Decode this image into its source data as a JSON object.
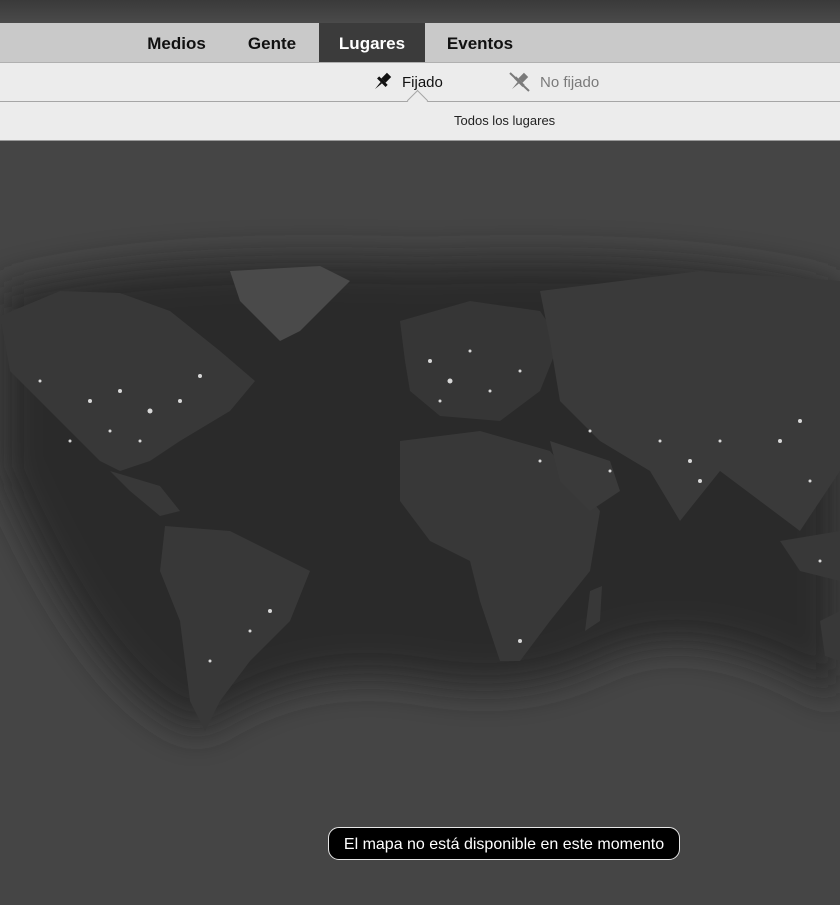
{
  "tabs": [
    {
      "label": "Medios",
      "active": false
    },
    {
      "label": "Gente",
      "active": false
    },
    {
      "label": "Lugares",
      "active": true
    },
    {
      "label": "Eventos",
      "active": false
    }
  ],
  "pin_filter": {
    "pinned_label": "Fijado",
    "unpinned_label": "No fijado",
    "pinned_icon": "pin-icon",
    "unpinned_icon": "pin-off-icon"
  },
  "places_filter": {
    "label": "Todos los lugares"
  },
  "map": {
    "notice": "El mapa no está disponible en este momento"
  },
  "colors": {
    "active_tab": "#3b3b3b",
    "tab_bar": "#c9c9c9",
    "map_background": "#454545",
    "land": "#333333",
    "ocean": "#2a2a2a",
    "city_lights": "#ffffff"
  }
}
